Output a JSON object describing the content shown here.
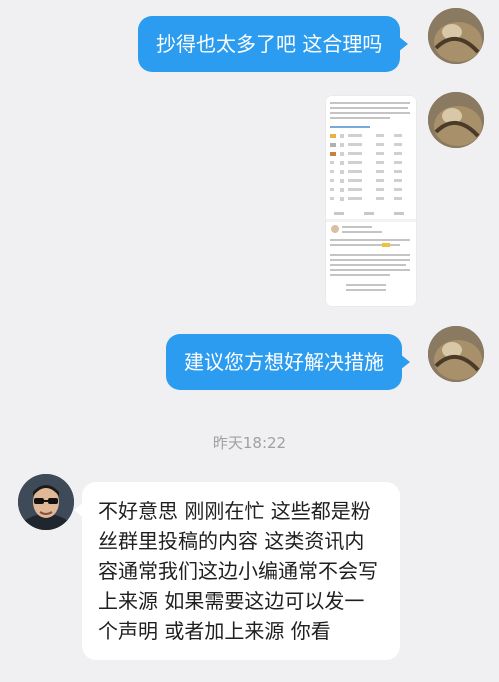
{
  "messages": [
    {
      "direction": "out",
      "text": "抄得也太多了吧 这合理吗"
    },
    {
      "direction": "out",
      "type": "image",
      "content": "screenshot-thumbnail"
    },
    {
      "direction": "out",
      "text": "建议您方想好解决措施"
    },
    {
      "direction": "in",
      "text": "不好意思 刚刚在忙 这些都是粉丝群里投稿的内容 这类资讯内容通常我们这边小编通常不会写上来源 如果需要这边可以发一个声明 或者加上来源 你看"
    }
  ],
  "timestamp": "昨天18:22",
  "colors": {
    "background": "#f0f0f2",
    "outgoing_bubble": "#2c9cf0",
    "incoming_bubble": "#ffffff",
    "timestamp_text": "#a0a0a0"
  }
}
